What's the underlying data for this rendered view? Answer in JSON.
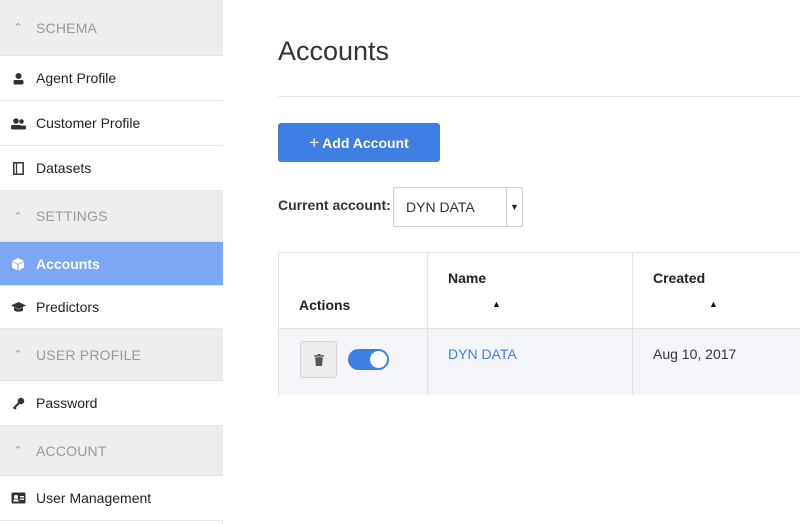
{
  "sidebar": {
    "sections": [
      {
        "title": "SCHEMA",
        "items": [
          {
            "label": "Agent Profile",
            "icon": "agent-icon"
          },
          {
            "label": "Customer Profile",
            "icon": "users-icon"
          },
          {
            "label": "Datasets",
            "icon": "dataset-icon"
          }
        ]
      },
      {
        "title": "SETTINGS",
        "items": [
          {
            "label": "Accounts",
            "icon": "cube-icon",
            "active": true
          },
          {
            "label": "Predictors",
            "icon": "graduation-cap-icon"
          }
        ]
      },
      {
        "title": "USER PROFILE",
        "items": [
          {
            "label": "Password",
            "icon": "key-icon"
          }
        ]
      },
      {
        "title": "ACCOUNT",
        "items": [
          {
            "label": "User Management",
            "icon": "id-card-icon"
          }
        ]
      }
    ]
  },
  "main": {
    "title": "Accounts",
    "add_button_label": "Add Account",
    "add_button_icon": "+",
    "current_account_label": "Current account:",
    "current_account_value": "DYN DATA",
    "table": {
      "headers": {
        "actions": "Actions",
        "name": "Name",
        "created": "Created"
      },
      "rows": [
        {
          "name": "DYN DATA",
          "created": "Aug 10, 2017",
          "enabled": true
        }
      ]
    }
  },
  "colors": {
    "accent": "#3f7fe3",
    "active_sidebar": "#7ba7f4",
    "section_bg": "#ededed"
  }
}
